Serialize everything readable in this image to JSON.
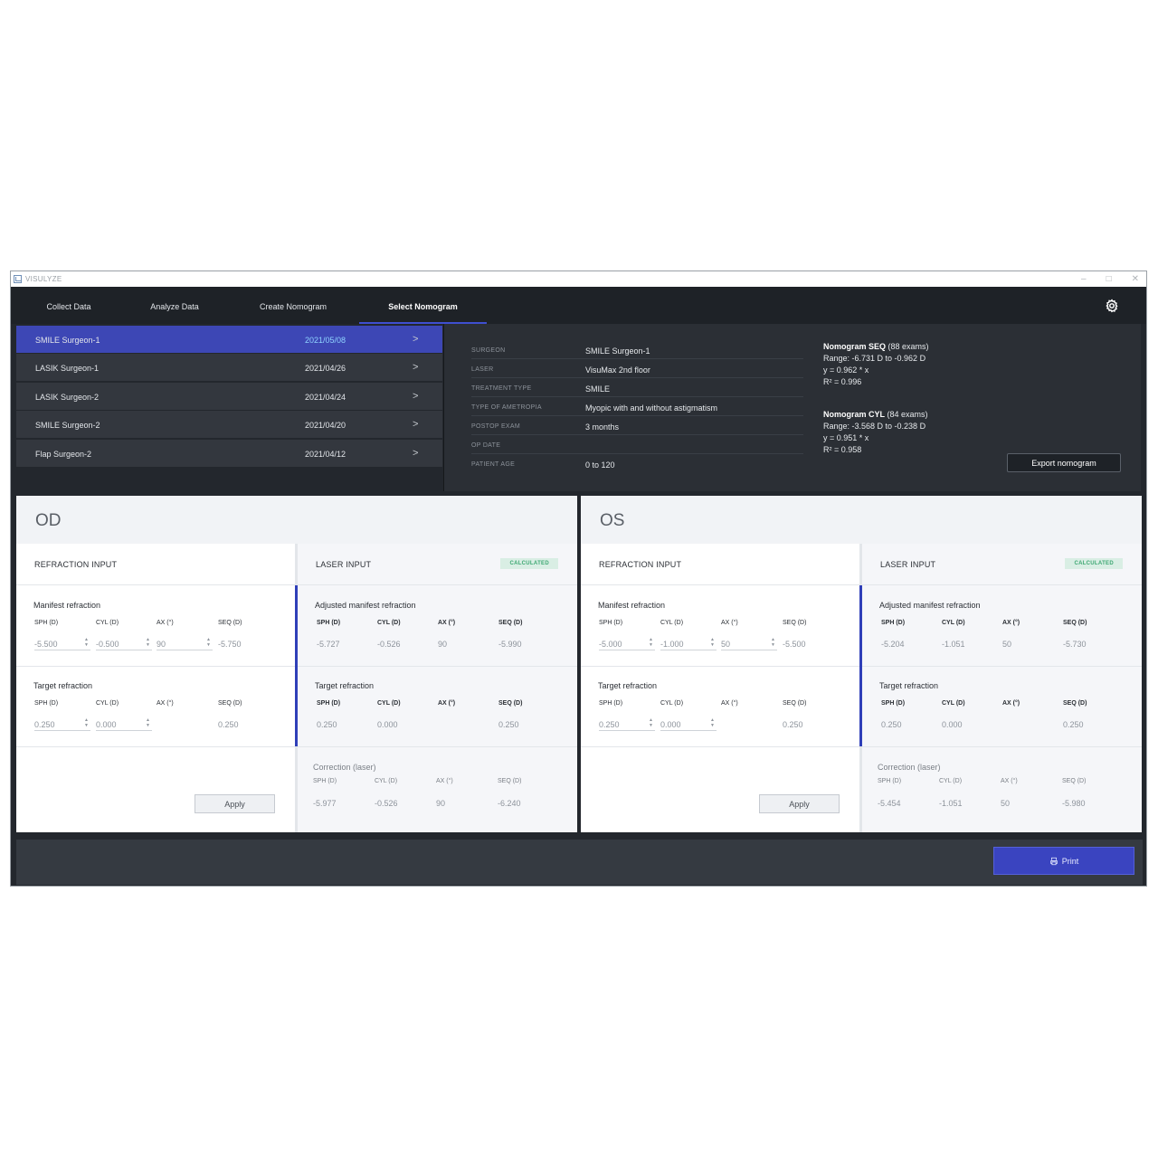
{
  "window": {
    "title": "VISULYZE"
  },
  "nav": {
    "tabs": [
      {
        "label": "Collect Data"
      },
      {
        "label": "Analyze Data"
      },
      {
        "label": "Create Nomogram"
      },
      {
        "label": "Select Nomogram",
        "active": true
      }
    ]
  },
  "nomograms": [
    {
      "name": "SMILE Surgeon-1",
      "date": "2021/05/08",
      "selected": true
    },
    {
      "name": "LASIK Surgeon-1",
      "date": "2021/04/26"
    },
    {
      "name": "LASIK Surgeon-2",
      "date": "2021/04/24"
    },
    {
      "name": "SMILE Surgeon-2",
      "date": "2021/04/20"
    },
    {
      "name": "Flap Surgeon-2",
      "date": "2021/04/12"
    }
  ],
  "details": [
    {
      "key": "SURGEON",
      "value": "SMILE Surgeon-1"
    },
    {
      "key": "LASER",
      "value": "VisuMax 2nd floor"
    },
    {
      "key": "TREATMENT TYPE",
      "value": "SMILE"
    },
    {
      "key": "TYPE OF AMETROPIA",
      "value": "Myopic with and without astigmatism"
    },
    {
      "key": "POSTOP EXAM",
      "value": "3 months"
    },
    {
      "key": "OP DATE",
      "value": ""
    },
    {
      "key": "PATIENT AGE",
      "value": "0 to 120"
    }
  ],
  "stats": {
    "seq": {
      "title": "Nomogram SEQ",
      "count": "(88 exams)",
      "range": "Range: -6.731 D to -0.962 D",
      "eq": "y = 0.962 * x",
      "r2": "R² = 0.996"
    },
    "cyl": {
      "title": "Nomogram CYL",
      "count": "(84 exams)",
      "range": "Range: -3.568 D to -0.238 D",
      "eq": "y = 0.951 * x",
      "r2": "R² = 0.958"
    }
  },
  "export_label": "Export nomogram",
  "labels": {
    "refraction_input": "REFRACTION INPUT",
    "laser_input": "LASER INPUT",
    "calculated": "CALCULATED",
    "manifest": "Manifest refraction",
    "adjusted": "Adjusted manifest refraction",
    "target": "Target refraction",
    "correction": "Correction (laser)",
    "sph": "SPH (D)",
    "cyl": "CYL (D)",
    "ax": "AX (°)",
    "seq": "SEQ (D)",
    "apply": "Apply"
  },
  "od": {
    "label": "OD",
    "manifest": {
      "sph": "-5.500",
      "cyl": "-0.500",
      "ax": "90",
      "seq": "-5.750"
    },
    "target": {
      "sph": "0.250",
      "cyl": "0.000",
      "seq": "0.250"
    },
    "adjusted": {
      "sph": "-5.727",
      "cyl": "-0.526",
      "ax": "90",
      "seq": "-5.990"
    },
    "laser_target": {
      "sph": "0.250",
      "cyl": "0.000",
      "seq": "0.250"
    },
    "correction": {
      "sph": "-5.977",
      "cyl": "-0.526",
      "ax": "90",
      "seq": "-6.240"
    }
  },
  "os": {
    "label": "OS",
    "manifest": {
      "sph": "-5.000",
      "cyl": "-1.000",
      "ax": "50",
      "seq": "-5.500"
    },
    "target": {
      "sph": "0.250",
      "cyl": "0.000",
      "seq": "0.250"
    },
    "adjusted": {
      "sph": "-5.204",
      "cyl": "-1.051",
      "ax": "50",
      "seq": "-5.730"
    },
    "laser_target": {
      "sph": "0.250",
      "cyl": "0.000",
      "seq": "0.250"
    },
    "correction": {
      "sph": "-5.454",
      "cyl": "-1.051",
      "ax": "50",
      "seq": "-5.980"
    }
  },
  "print_label": "Print",
  "colors": {
    "accent": "#3d47b5",
    "badge_bg": "#d9eee4",
    "badge_fg": "#3ea873"
  }
}
